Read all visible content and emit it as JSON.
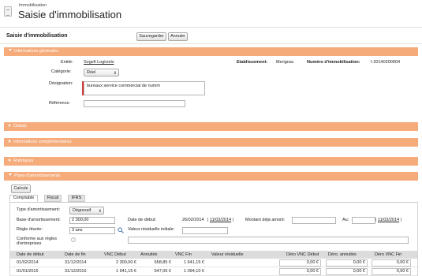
{
  "header": {
    "breadcrumb": "Immobilisation",
    "title": "Saisie d'immobilisation"
  },
  "toolbar": {
    "title": "Saisie d'immobilisation",
    "save_label": "Sauvegarder",
    "cancel_label": "Annuler"
  },
  "sections": {
    "general": "Informations générales",
    "details": "Détails",
    "complementary": "Informations complémentaires",
    "rubriques": "Rubriques",
    "amortization": "Plans d'amortissements"
  },
  "general": {
    "entity_label": "Entité:",
    "entity_value": "Sogefi Logiciels",
    "establishment_label": "Etablissement:",
    "establishment_value": "Merignac",
    "number_label": "Numéro d'immobilisation:",
    "number_value": "I-20140200004",
    "category_label": "Catégorie:",
    "category_value": "Réel",
    "designation_label": "Désignation:",
    "designation_value": "bureaux service commercial de numm",
    "reference_label": "Référence:",
    "reference_value": ""
  },
  "amortization": {
    "calc_label": "Calcule",
    "tabs": [
      "Comptable",
      "Fiscal",
      "IFRS"
    ],
    "type_label": "Type d'amortissement:",
    "type_value": "Dégressif",
    "base_label": "Base d'amortissement:",
    "base_value": "2 300,00",
    "start_label": "Date de début:",
    "start_value": "26/02/2014",
    "start_link": "11/03/2014",
    "already_label": "Montant déjà amorti:",
    "already_value": "",
    "au_label": "Au:",
    "au_value": "",
    "au_link": "11/03/2014",
    "duration_label": "Règle /durée:",
    "duration_value": "3 ans",
    "residual_label": "Valeur résiduelle initiale:",
    "residual_value": "",
    "compliant_label_1": "Conforme aux règles",
    "compliant_label_2": "d'entreprises",
    "columns": [
      "Date de début",
      "Date de fin",
      "VNC Début",
      "Annuités",
      "VNC Fin",
      "Valeur résiduelle",
      "Déro VNC Début",
      "Déro. annuités",
      "Déro VNC Fin"
    ],
    "rows": [
      [
        "01/02/2014",
        "31/12/2014",
        "2 300,00 €",
        "658,85 €",
        "1 641,15 €",
        "",
        "0,00 €",
        "0,00 €",
        "0,00 €"
      ],
      [
        "01/01/2015",
        "31/12/2015",
        "1 641,15 €",
        "547,05 €",
        "1 094,10 €",
        "",
        "0,00 €",
        "0,00 €",
        "0,00 €"
      ]
    ]
  },
  "colors": {
    "section_bar": "#f6ab7b",
    "required_marker": "#d43a3a"
  }
}
